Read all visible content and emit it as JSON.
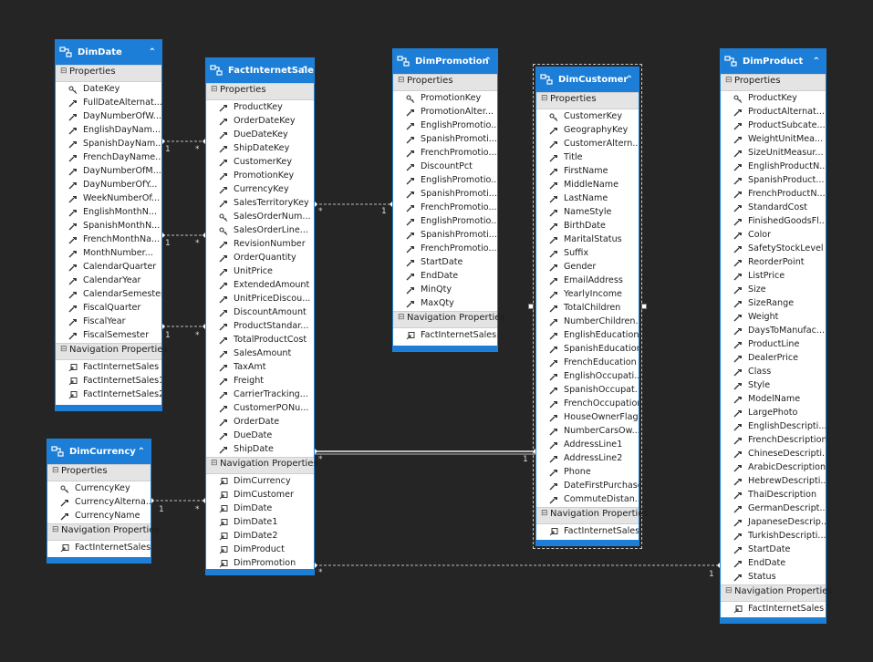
{
  "entities": [
    {
      "id": "dimdate",
      "name": "DimDate",
      "properties_label": "Properties",
      "navigation_label": "Navigation Properties",
      "properties": [
        "DateKey",
        "FullDateAlternat...",
        "DayNumberOfW...",
        "EnglishDayNam...",
        "SpanishDayNam...",
        "FrenchDayName...",
        "DayNumberOfM...",
        "DayNumberOfY...",
        "WeekNumberOf...",
        "EnglishMonthN...",
        "SpanishMonthN...",
        "FrenchMonthNa...",
        "MonthNumber...",
        "CalendarQuarter",
        "CalendarYear",
        "CalendarSemester",
        "FiscalQuarter",
        "FiscalYear",
        "FiscalSemester"
      ],
      "keys": [
        "DateKey"
      ],
      "navigation": [
        "FactInternetSales",
        "FactInternetSales1",
        "FactInternetSales2"
      ]
    },
    {
      "id": "factinternetsale",
      "name": "FactInternetSale",
      "properties_label": "Properties",
      "navigation_label": "Navigation Properties",
      "properties": [
        "ProductKey",
        "OrderDateKey",
        "DueDateKey",
        "ShipDateKey",
        "CustomerKey",
        "PromotionKey",
        "CurrencyKey",
        "SalesTerritoryKey",
        "SalesOrderNum...",
        "SalesOrderLine...",
        "RevisionNumber",
        "OrderQuantity",
        "UnitPrice",
        "ExtendedAmount",
        "UnitPriceDiscou...",
        "DiscountAmount",
        "ProductStandar...",
        "TotalProductCost",
        "SalesAmount",
        "TaxAmt",
        "Freight",
        "CarrierTracking...",
        "CustomerPONu...",
        "OrderDate",
        "DueDate",
        "ShipDate"
      ],
      "keys": [
        "SalesOrderNum...",
        "SalesOrderLine..."
      ],
      "navigation": [
        "DimCurrency",
        "DimCustomer",
        "DimDate",
        "DimDate1",
        "DimDate2",
        "DimProduct",
        "DimPromotion"
      ]
    },
    {
      "id": "dimpromotion",
      "name": "DimPromotion",
      "properties_label": "Properties",
      "navigation_label": "Navigation Properties",
      "properties": [
        "PromotionKey",
        "PromotionAlter...",
        "EnglishPromotio...",
        "SpanishPromoti...",
        "FrenchPromotio...",
        "DiscountPct",
        "EnglishPromotio...",
        "SpanishPromoti...",
        "FrenchPromotio...",
        "EnglishPromotio...",
        "SpanishPromoti...",
        "FrenchPromotio...",
        "StartDate",
        "EndDate",
        "MinQty",
        "MaxQty"
      ],
      "keys": [
        "PromotionKey"
      ],
      "navigation": [
        "FactInternetSales"
      ]
    },
    {
      "id": "dimcustomer",
      "name": "DimCustomer",
      "properties_label": "Properties",
      "navigation_label": "Navigation Properties",
      "properties": [
        "CustomerKey",
        "GeographyKey",
        "CustomerAltern...",
        "Title",
        "FirstName",
        "MiddleName",
        "LastName",
        "NameStyle",
        "BirthDate",
        "MaritalStatus",
        "Suffix",
        "Gender",
        "EmailAddress",
        "YearlyIncome",
        "TotalChildren",
        "NumberChildren...",
        "EnglishEducation",
        "SpanishEducation",
        "FrenchEducation",
        "EnglishOccupati...",
        "SpanishOccupat...",
        "FrenchOccupation",
        "HouseOwnerFlag",
        "NumberCarsOw...",
        "AddressLine1",
        "AddressLine2",
        "Phone",
        "DateFirstPurchase",
        "CommuteDistan..."
      ],
      "keys": [
        "CustomerKey"
      ],
      "navigation": [
        "FactInternetSales"
      ]
    },
    {
      "id": "dimproduct",
      "name": "DimProduct",
      "properties_label": "Properties",
      "navigation_label": "Navigation Properties",
      "properties": [
        "ProductKey",
        "ProductAlternat...",
        "ProductSubcate...",
        "WeightUnitMea...",
        "SizeUnitMeasur...",
        "EnglishProductN...",
        "SpanishProduct...",
        "FrenchProductN...",
        "StandardCost",
        "FinishedGoodsFl...",
        "Color",
        "SafetyStockLevel",
        "ReorderPoint",
        "ListPrice",
        "Size",
        "SizeRange",
        "Weight",
        "DaysToManufac...",
        "ProductLine",
        "DealerPrice",
        "Class",
        "Style",
        "ModelName",
        "LargePhoto",
        "EnglishDescripti...",
        "FrenchDescription",
        "ChineseDescripti...",
        "ArabicDescription",
        "HebrewDescripti...",
        "ThaiDescription",
        "GermanDescript...",
        "JapaneseDescrip...",
        "TurkishDescripti...",
        "StartDate",
        "EndDate",
        "Status"
      ],
      "keys": [
        "ProductKey"
      ],
      "navigation": [
        "FactInternetSales"
      ]
    },
    {
      "id": "dimcurrency",
      "name": "DimCurrency",
      "properties_label": "Properties",
      "navigation_label": "Navigation Properties",
      "properties": [
        "CurrencyKey",
        "CurrencyAlterna...",
        "CurrencyName"
      ],
      "keys": [
        "CurrencyKey"
      ],
      "navigation": [
        "FactInternetSales"
      ]
    }
  ],
  "associations": [
    {
      "from": "DimDate",
      "to": "FactInternetSale",
      "from_mult": "1",
      "to_mult": "*"
    },
    {
      "from": "DimDate",
      "to": "FactInternetSale",
      "from_mult": "1",
      "to_mult": "*"
    },
    {
      "from": "DimDate",
      "to": "FactInternetSale",
      "from_mult": "1",
      "to_mult": "*"
    },
    {
      "from": "DimCurrency",
      "to": "FactInternetSale",
      "from_mult": "1",
      "to_mult": "*"
    },
    {
      "from": "FactInternetSale",
      "to": "DimPromotion",
      "from_mult": "*",
      "to_mult": "1"
    },
    {
      "from": "FactInternetSale",
      "to": "DimCustomer",
      "from_mult": "*",
      "to_mult": "1"
    },
    {
      "from": "FactInternetSale",
      "to": "DimProduct",
      "from_mult": "*",
      "to_mult": "1"
    }
  ],
  "selected_entity": "DimCustomer",
  "colors": {
    "canvas": "#252526",
    "header": "#1c7ed6",
    "section": "#e4e4e4",
    "connector": "#bcbcbc"
  },
  "icons": {
    "entity": "entity-icon",
    "key": "key-icon",
    "property": "property-icon",
    "navigation": "navigation-property-icon",
    "collapse": "chevron-up-icon",
    "section": "minus-icon"
  }
}
